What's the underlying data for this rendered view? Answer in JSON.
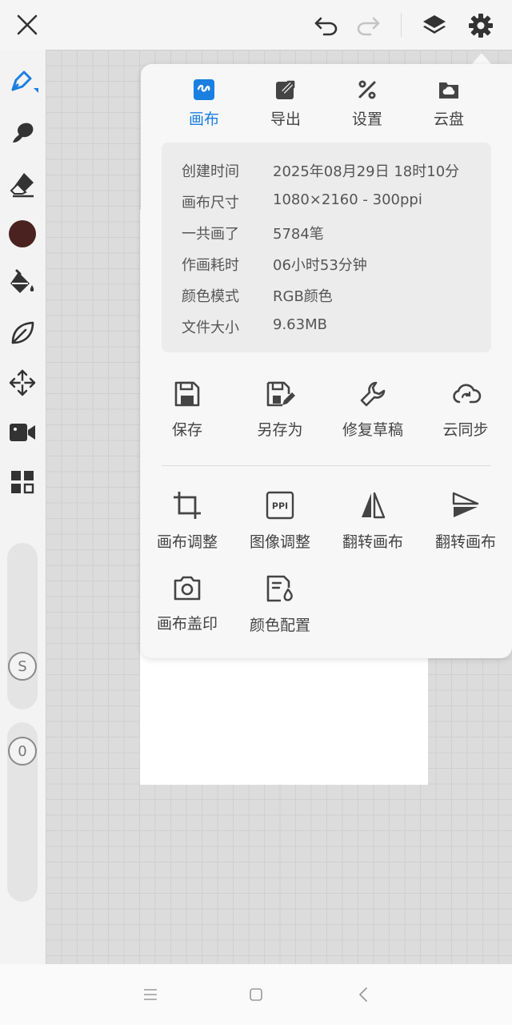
{
  "popup": {
    "tabs": [
      {
        "label": "画布",
        "active": true
      },
      {
        "label": "导出",
        "active": false
      },
      {
        "label": "设置",
        "active": false
      },
      {
        "label": "云盘",
        "active": false
      }
    ],
    "info": [
      {
        "key": "创建时间",
        "value": "2025年08月29日 18时10分"
      },
      {
        "key": "画布尺寸",
        "value": "1080×2160 - 300ppi"
      },
      {
        "key": "一共画了",
        "value": "5784笔"
      },
      {
        "key": "作画耗时",
        "value": "06小时53分钟"
      },
      {
        "key": "颜色模式",
        "value": "RGB颜色"
      },
      {
        "key": "文件大小",
        "value": "9.63MB"
      }
    ],
    "file_actions": [
      {
        "label": "保存"
      },
      {
        "label": "另存为"
      },
      {
        "label": "修复草稿"
      },
      {
        "label": "云同步"
      }
    ],
    "canvas_actions": [
      {
        "label": "画布调整"
      },
      {
        "label": "图像调整"
      },
      {
        "label": "翻转画布"
      },
      {
        "label": "翻转画布"
      },
      {
        "label": "画布盖印"
      },
      {
        "label": "颜色配置"
      }
    ],
    "ppi_icon_text": "PPI"
  },
  "sidebar": {
    "brush_size_badge": "S",
    "opacity_badge": "0"
  },
  "colors": {
    "accent": "#1a7fe0",
    "current_color": "#4a2220",
    "icon": "#333333"
  },
  "icons": {
    "topbar": [
      "close-icon",
      "undo-icon",
      "redo-icon",
      "layers-icon",
      "gear-icon"
    ],
    "sidebar": [
      "pen-icon",
      "smudge-icon",
      "eraser-icon",
      "color-swatch",
      "fill-bucket-icon",
      "leaf-icon",
      "move-icon",
      "video-camera-icon",
      "grid-icon"
    ],
    "navbar": [
      "menu-icon",
      "home-square-icon",
      "back-chevron-icon"
    ]
  }
}
